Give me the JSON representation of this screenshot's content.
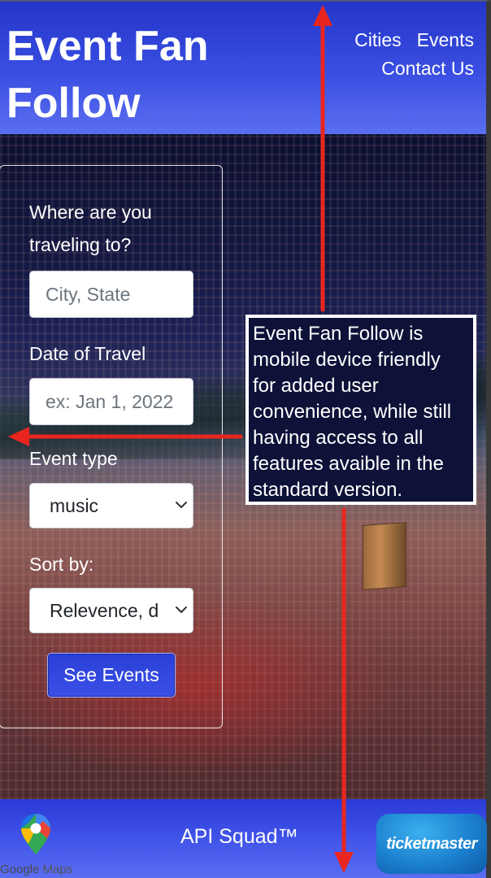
{
  "header": {
    "title": "Event Fan Follow",
    "nav": [
      "Cities",
      "Events",
      "Contact Us"
    ]
  },
  "search": {
    "destination_label": "Where are you traveling to?",
    "destination_placeholder": "City, State",
    "date_label": "Date of Travel",
    "date_placeholder": "ex: Jan 1, 2022",
    "event_type_label": "Event type",
    "event_type_value": "music",
    "sort_label": "Sort by:",
    "sort_value": "Relevence, d",
    "submit_label": "See Events"
  },
  "annotation": {
    "text": "Event Fan Follow is mobile device friendly for added user convenience, while still having access to all features avaible in the standard version."
  },
  "footer": {
    "maps_label_google": "Google",
    "maps_label_maps": "Maps",
    "credit": "API Squad™",
    "ticketmaster_label": "ticketmaster"
  },
  "colors": {
    "accent": "#2f43dd",
    "annotation_arrow": "#e8261f"
  },
  "icons": [
    "google-maps-pin-icon",
    "chevron-down-icon",
    "ticketmaster-logo"
  ]
}
